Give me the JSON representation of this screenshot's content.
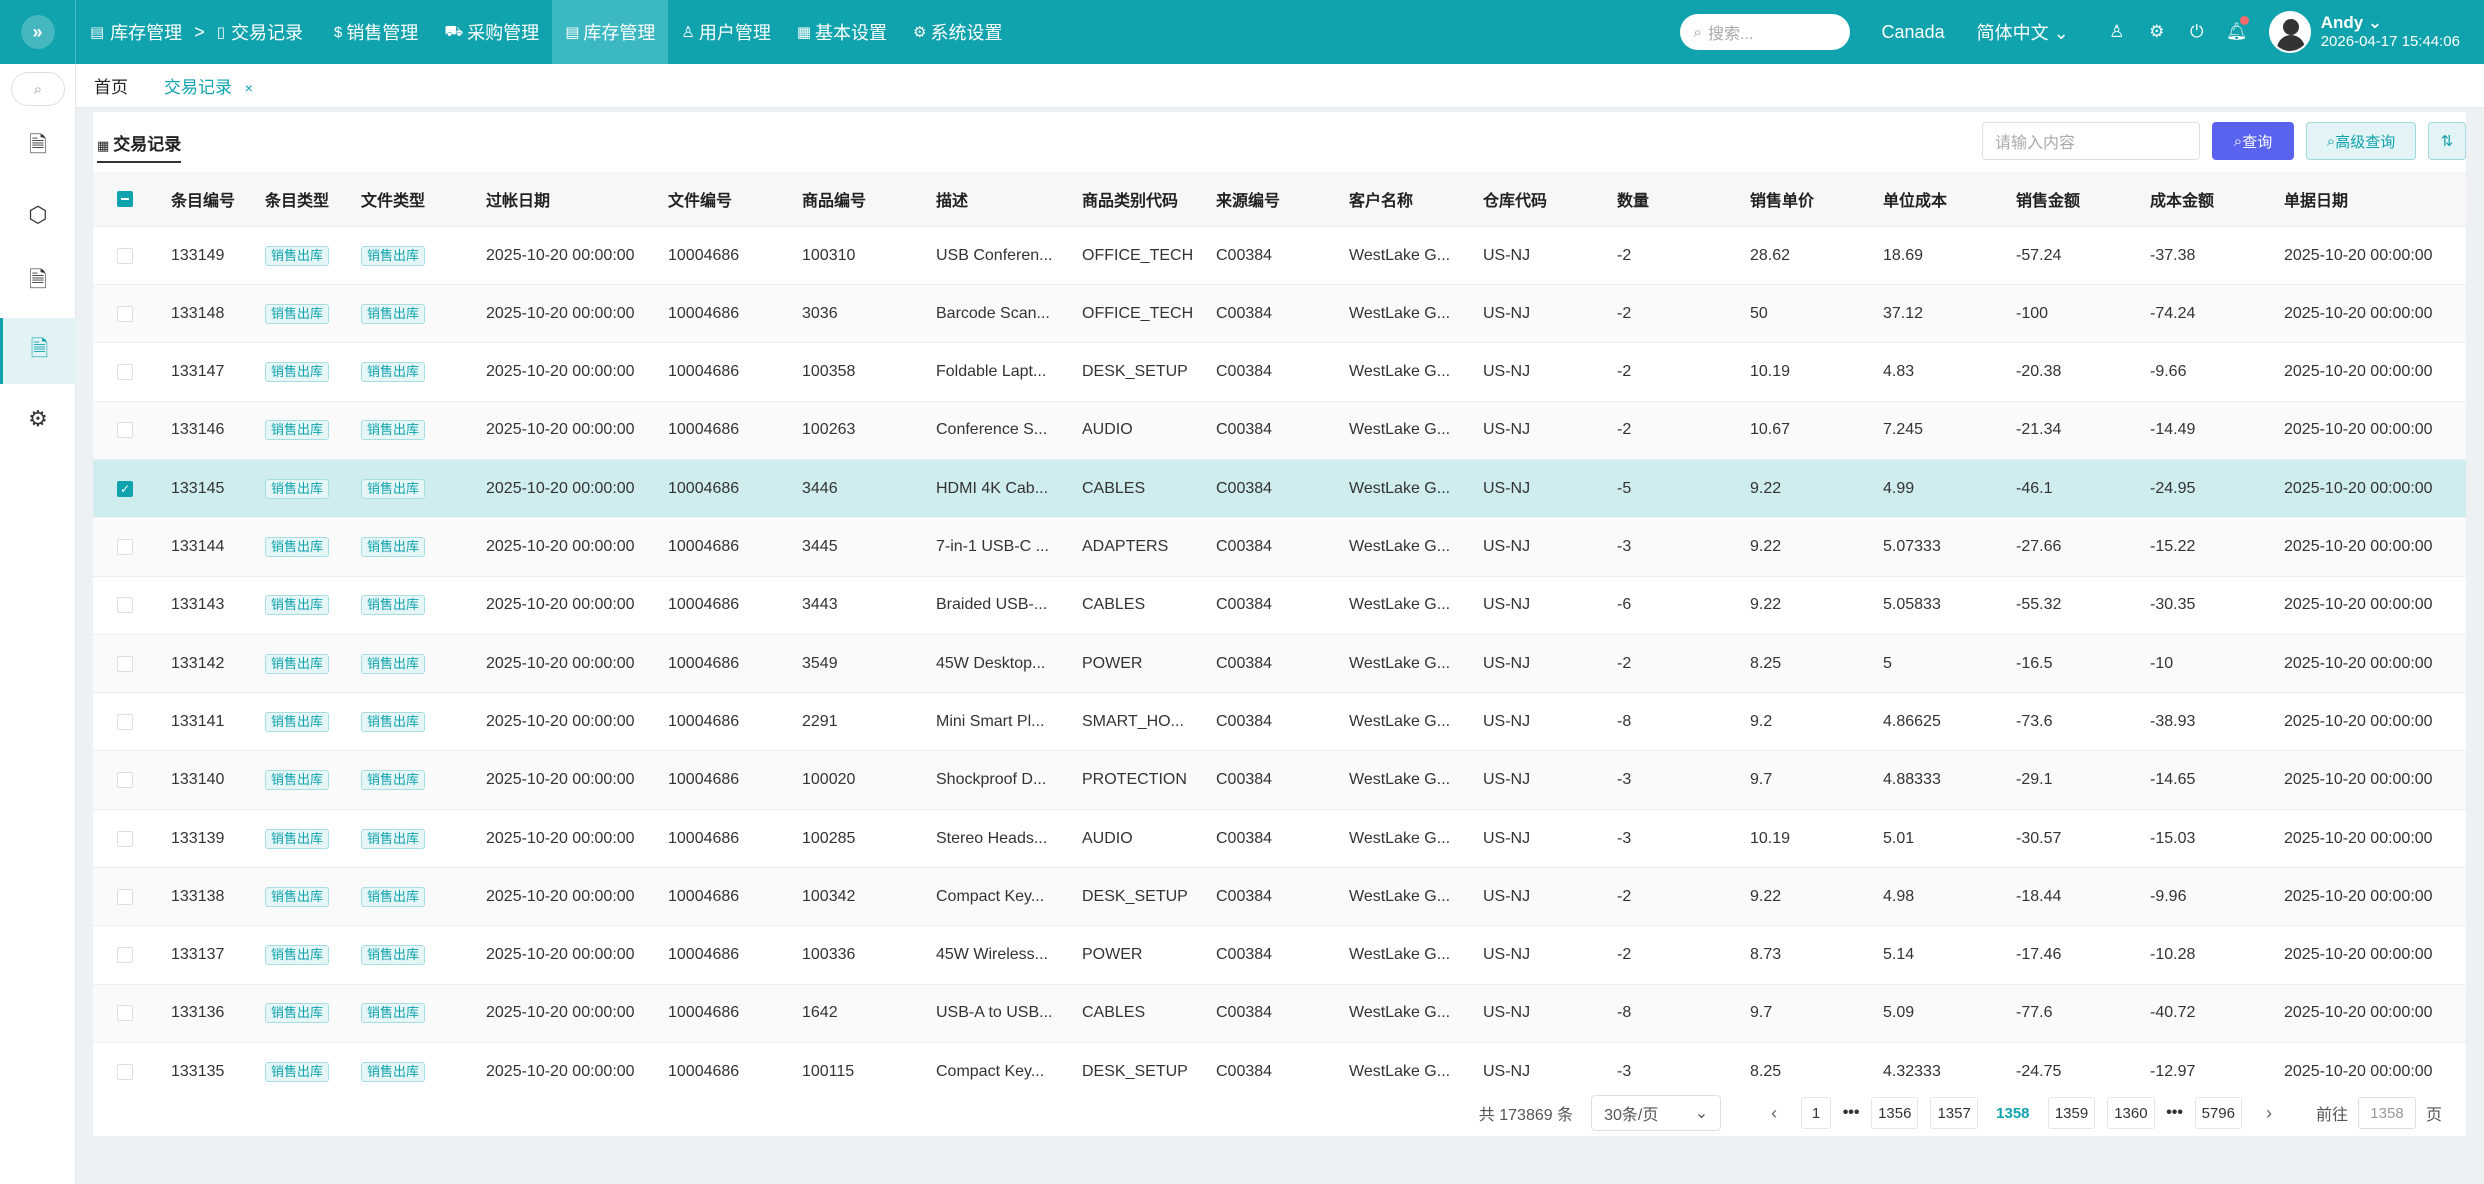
{
  "header": {
    "crumb_root": "库存管理",
    "crumb_sep": ">",
    "crumb_current": "交易记录",
    "nav": [
      {
        "label": "销售管理",
        "icon": "dollar-icon"
      },
      {
        "label": "采购管理",
        "icon": "cart-icon"
      },
      {
        "label": "库存管理",
        "icon": "database-icon"
      },
      {
        "label": "用户管理",
        "icon": "user-icon"
      },
      {
        "label": "基本设置",
        "icon": "grid-icon"
      },
      {
        "label": "系统设置",
        "icon": "gear-icon"
      }
    ],
    "search_placeholder": "搜索...",
    "region": "Canada",
    "language": "简体中文",
    "user_name": "Andy",
    "user_time": "2026-04-17 15:44:06"
  },
  "tabs": {
    "home": "首页",
    "current": "交易记录",
    "close": "×"
  },
  "panel": {
    "title": "交易记录",
    "search_placeholder": "请输入内容",
    "query_label": "查询",
    "advanced_label": "高级查询"
  },
  "table": {
    "columns": [
      "条目编号",
      "条目类型",
      "文件类型",
      "过帐日期",
      "文件编号",
      "商品编号",
      "描述",
      "商品类别代码",
      "来源编号",
      "客户名称",
      "仓库代码",
      "数量",
      "销售单价",
      "单位成本",
      "销售金额",
      "成本金额",
      "单据日期"
    ],
    "rows": [
      [
        "133149",
        "销售出库",
        "销售出库",
        "2025-10-20 00:00:00",
        "10004686",
        "100310",
        "USB Conferen...",
        "OFFICE_TECH",
        "C00384",
        "WestLake G...",
        "US-NJ",
        "-2",
        "28.62",
        "18.69",
        "-57.24",
        "-37.38",
        "2025-10-20 00:00:00"
      ],
      [
        "133148",
        "销售出库",
        "销售出库",
        "2025-10-20 00:00:00",
        "10004686",
        "3036",
        "Barcode Scan...",
        "OFFICE_TECH",
        "C00384",
        "WestLake G...",
        "US-NJ",
        "-2",
        "50",
        "37.12",
        "-100",
        "-74.24",
        "2025-10-20 00:00:00"
      ],
      [
        "133147",
        "销售出库",
        "销售出库",
        "2025-10-20 00:00:00",
        "10004686",
        "100358",
        "Foldable Lapt...",
        "DESK_SETUP",
        "C00384",
        "WestLake G...",
        "US-NJ",
        "-2",
        "10.19",
        "4.83",
        "-20.38",
        "-9.66",
        "2025-10-20 00:00:00"
      ],
      [
        "133146",
        "销售出库",
        "销售出库",
        "2025-10-20 00:00:00",
        "10004686",
        "100263",
        "Conference S...",
        "AUDIO",
        "C00384",
        "WestLake G...",
        "US-NJ",
        "-2",
        "10.67",
        "7.245",
        "-21.34",
        "-14.49",
        "2025-10-20 00:00:00"
      ],
      [
        "133145",
        "销售出库",
        "销售出库",
        "2025-10-20 00:00:00",
        "10004686",
        "3446",
        "HDMI 4K Cab...",
        "CABLES",
        "C00384",
        "WestLake G...",
        "US-NJ",
        "-5",
        "9.22",
        "4.99",
        "-46.1",
        "-24.95",
        "2025-10-20 00:00:00"
      ],
      [
        "133144",
        "销售出库",
        "销售出库",
        "2025-10-20 00:00:00",
        "10004686",
        "3445",
        "7-in-1 USB-C ...",
        "ADAPTERS",
        "C00384",
        "WestLake G...",
        "US-NJ",
        "-3",
        "9.22",
        "5.07333",
        "-27.66",
        "-15.22",
        "2025-10-20 00:00:00"
      ],
      [
        "133143",
        "销售出库",
        "销售出库",
        "2025-10-20 00:00:00",
        "10004686",
        "3443",
        "Braided USB-...",
        "CABLES",
        "C00384",
        "WestLake G...",
        "US-NJ",
        "-6",
        "9.22",
        "5.05833",
        "-55.32",
        "-30.35",
        "2025-10-20 00:00:00"
      ],
      [
        "133142",
        "销售出库",
        "销售出库",
        "2025-10-20 00:00:00",
        "10004686",
        "3549",
        "45W Desktop...",
        "POWER",
        "C00384",
        "WestLake G...",
        "US-NJ",
        "-2",
        "8.25",
        "5",
        "-16.5",
        "-10",
        "2025-10-20 00:00:00"
      ],
      [
        "133141",
        "销售出库",
        "销售出库",
        "2025-10-20 00:00:00",
        "10004686",
        "2291",
        "Mini Smart Pl...",
        "SMART_HO...",
        "C00384",
        "WestLake G...",
        "US-NJ",
        "-8",
        "9.2",
        "4.86625",
        "-73.6",
        "-38.93",
        "2025-10-20 00:00:00"
      ],
      [
        "133140",
        "销售出库",
        "销售出库",
        "2025-10-20 00:00:00",
        "10004686",
        "100020",
        "Shockproof D...",
        "PROTECTION",
        "C00384",
        "WestLake G...",
        "US-NJ",
        "-3",
        "9.7",
        "4.88333",
        "-29.1",
        "-14.65",
        "2025-10-20 00:00:00"
      ],
      [
        "133139",
        "销售出库",
        "销售出库",
        "2025-10-20 00:00:00",
        "10004686",
        "100285",
        "Stereo Heads...",
        "AUDIO",
        "C00384",
        "WestLake G...",
        "US-NJ",
        "-3",
        "10.19",
        "5.01",
        "-30.57",
        "-15.03",
        "2025-10-20 00:00:00"
      ],
      [
        "133138",
        "销售出库",
        "销售出库",
        "2025-10-20 00:00:00",
        "10004686",
        "100342",
        "Compact Key...",
        "DESK_SETUP",
        "C00384",
        "WestLake G...",
        "US-NJ",
        "-2",
        "9.22",
        "4.98",
        "-18.44",
        "-9.96",
        "2025-10-20 00:00:00"
      ],
      [
        "133137",
        "销售出库",
        "销售出库",
        "2025-10-20 00:00:00",
        "10004686",
        "100336",
        "45W Wireless...",
        "POWER",
        "C00384",
        "WestLake G...",
        "US-NJ",
        "-2",
        "8.73",
        "5.14",
        "-17.46",
        "-10.28",
        "2025-10-20 00:00:00"
      ],
      [
        "133136",
        "销售出库",
        "销售出库",
        "2025-10-20 00:00:00",
        "10004686",
        "1642",
        "USB-A to USB...",
        "CABLES",
        "C00384",
        "WestLake G...",
        "US-NJ",
        "-8",
        "9.7",
        "5.09",
        "-77.6",
        "-40.72",
        "2025-10-20 00:00:00"
      ],
      [
        "133135",
        "销售出库",
        "销售出库",
        "2025-10-20 00:00:00",
        "10004686",
        "100115",
        "Compact Key...",
        "DESK_SETUP",
        "C00384",
        "WestLake G...",
        "US-NJ",
        "-3",
        "8.25",
        "4.32333",
        "-24.75",
        "-12.97",
        "2025-10-20 00:00:00"
      ]
    ],
    "selected_row": 4
  },
  "pagination": {
    "total": "共 173869 条",
    "page_size": "30条/页",
    "first": "1",
    "pages": [
      "1356",
      "1357",
      "1358",
      "1359",
      "1360"
    ],
    "current": "1358",
    "last": "5796",
    "goto_label": "前往",
    "goto_value": "1358",
    "page_suffix": "页"
  },
  "colors": {
    "header_bg": "#10a3ae",
    "active_nav": "#3bb8c2",
    "query_button": "#5a62f0",
    "selected_row": "#cfecef"
  }
}
